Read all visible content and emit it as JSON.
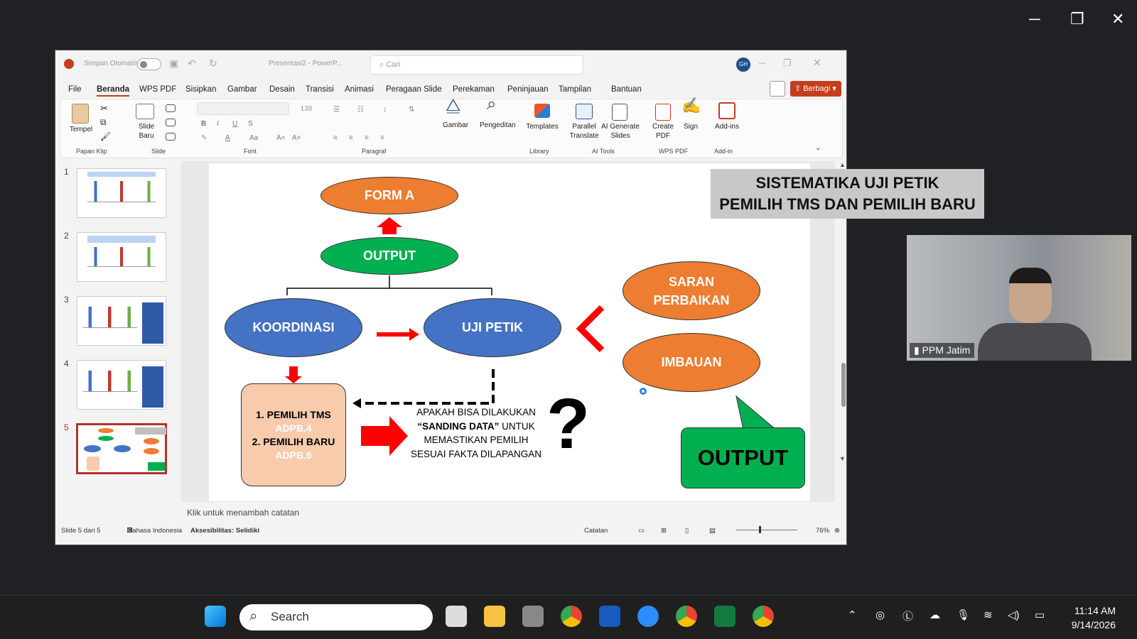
{
  "zoom_window": {
    "min": "─",
    "restore": "❐",
    "close": "✕"
  },
  "title": {
    "autosave_label": "Simpan Otomatis",
    "doc": "Presentasi2 - PowerP...",
    "search_placeholder": "Cari",
    "avatar": "GH"
  },
  "menu": [
    "File",
    "Beranda",
    "WPS PDF",
    "Sisipkan",
    "Gambar",
    "Desain",
    "Transisi",
    "Animasi",
    "Peragaan Slide",
    "Perekaman",
    "Peninjauan",
    "Tampilan",
    "Bantuan"
  ],
  "share_label": "Berbagi",
  "ribbon": {
    "paste": "Tempel",
    "new_slide": "Slide Baru",
    "font_size": "138",
    "picture": "Gambar",
    "editing": "Pengeditan",
    "templates": "Templates",
    "parallel": "Parallel Translate",
    "ai_slides": "AI Generate Slides",
    "create_pdf": "Create PDF",
    "sign": "Sign",
    "addins": "Add-ins"
  },
  "groups": {
    "clipboard": "Papan Klip",
    "slide": "Slide",
    "font": "Font",
    "paragraph": "Paragraf",
    "library": "Library",
    "ai": "AI Tools",
    "wps": "WPS PDF",
    "addin": "Add-in"
  },
  "thumbs": [
    "1",
    "2",
    "3",
    "4",
    "5"
  ],
  "slide": {
    "title1": "SISTEMATIKA UJI PETIK",
    "title2": "PEMILIH TMS DAN PEMILIH BARU",
    "form_a": "FORM A",
    "output": "OUTPUT",
    "koordinasi": "KOORDINASI",
    "uji_petik": "UJI PETIK",
    "saran1": "SARAN",
    "saran2": "PERBAIKAN",
    "imbauan": "IMBAUAN",
    "item1": "1.   PEMILIH TMS",
    "sub1": "ADPB.4",
    "item2": "2. PEMILIH BARU",
    "sub2": "ADPB.6",
    "q1": "APAKAH BISA DILAKUKAN",
    "q2a": "“SANDING DATA”",
    "q2b": " UNTUK",
    "q3": "MEMASTIKAN PEMILIH",
    "q4": "SESUAI FAKTA DILAPANGAN",
    "qmark": "?",
    "callout": "OUTPUT"
  },
  "notes": "Klik untuk menambah catatan",
  "status": {
    "slide": "Slide 5 dari 5",
    "lang": "Bahasa Indonesia",
    "access": "Aksesibilitas: Selidiki",
    "notes": "Catatan",
    "zoom": "76%"
  },
  "camera": {
    "name": "PPM Jatim"
  },
  "taskbar": {
    "search": "Search",
    "time": "11:14 AM",
    "date": "9/14/2026"
  }
}
